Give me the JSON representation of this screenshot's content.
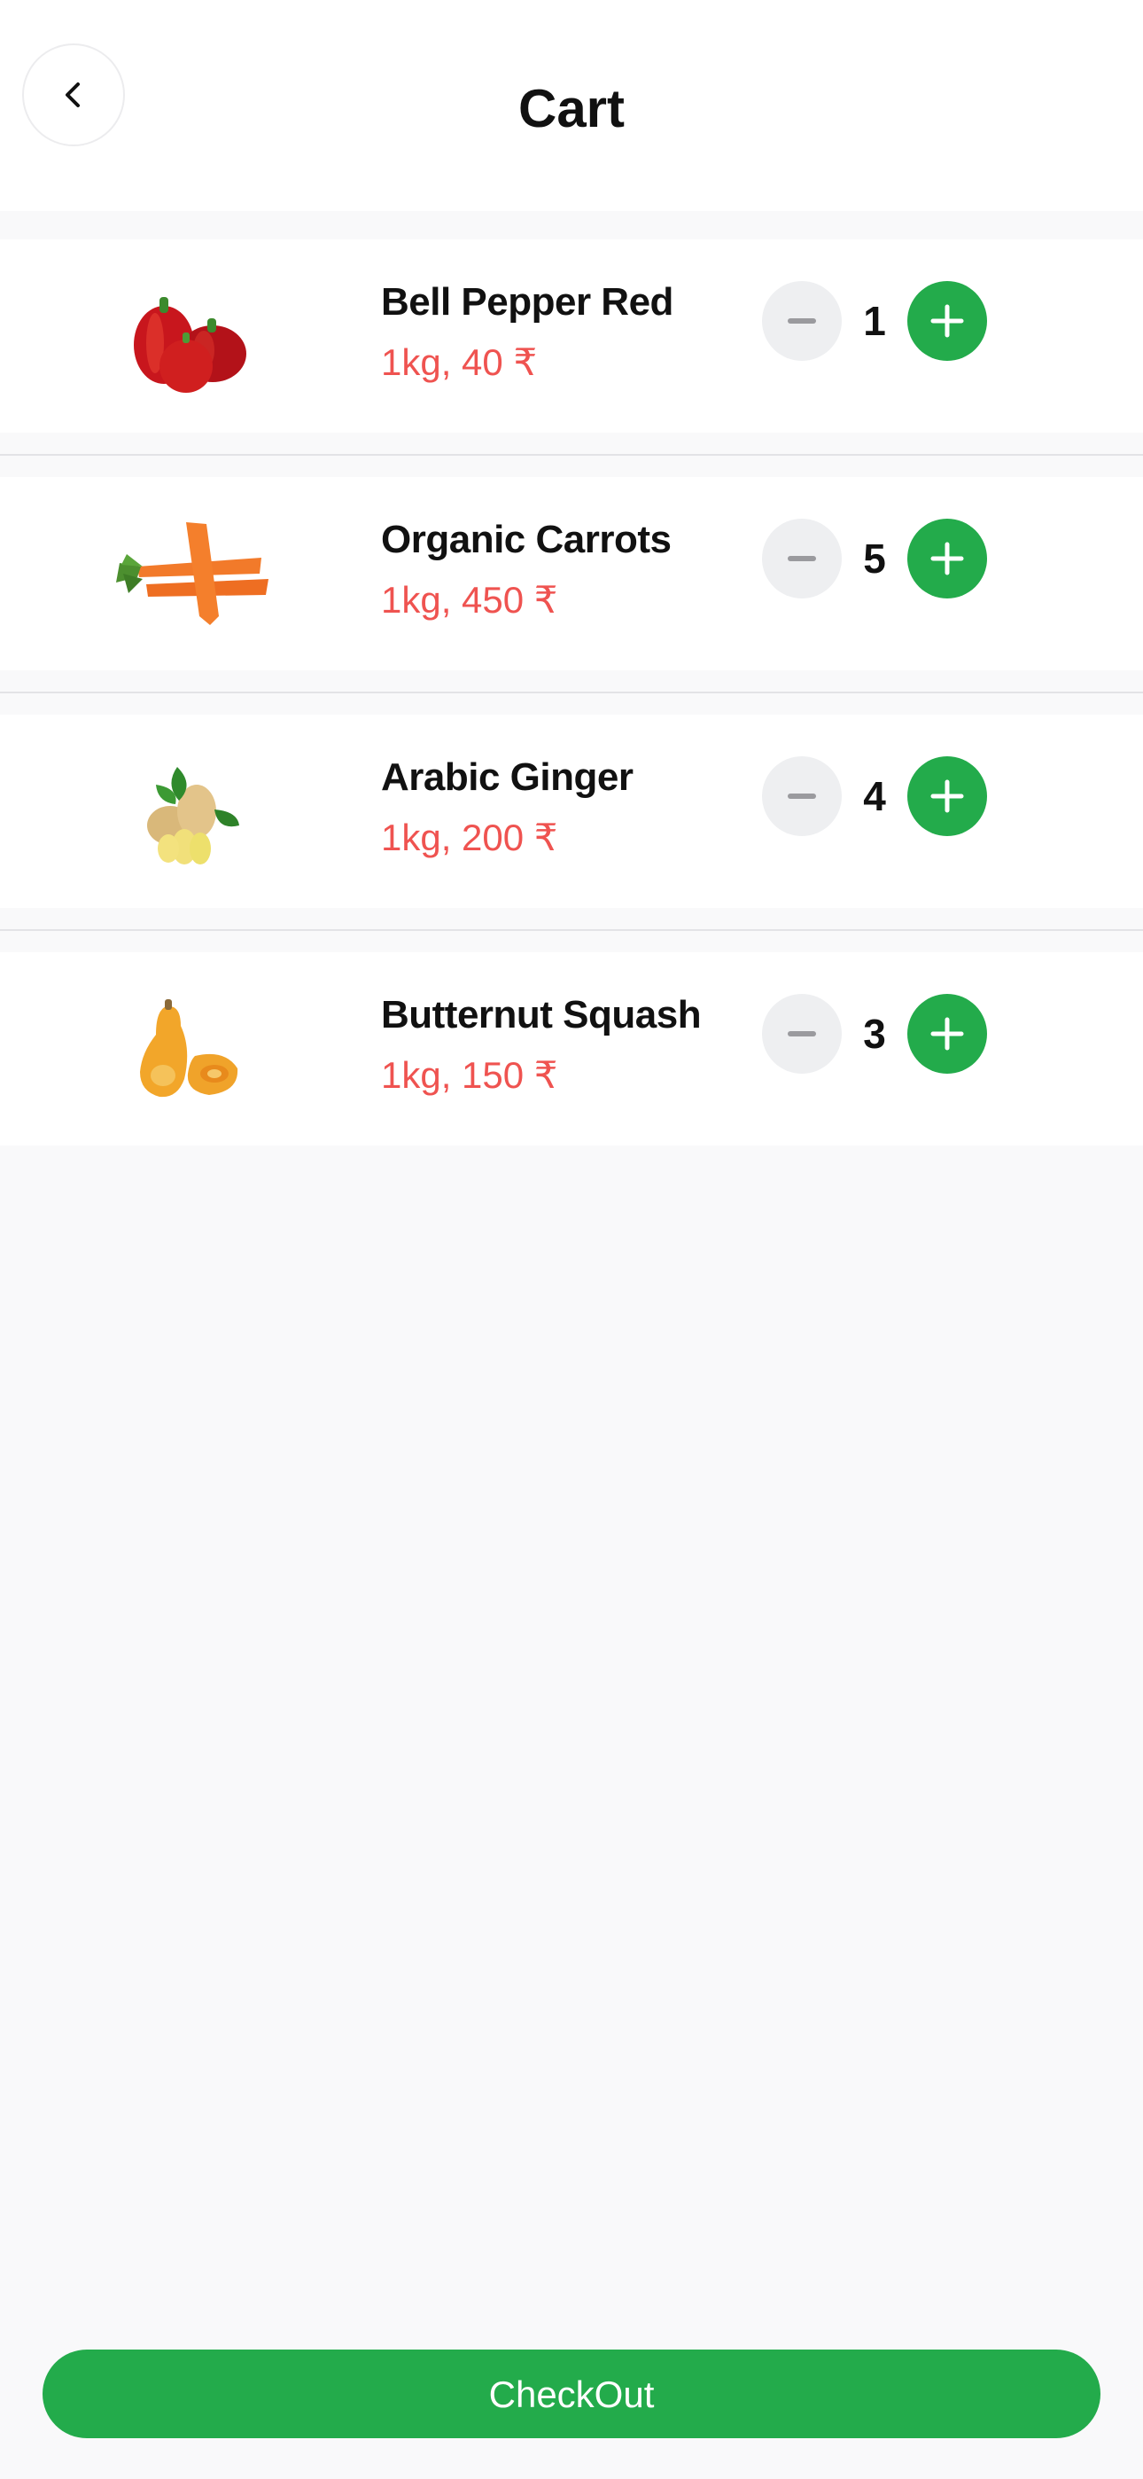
{
  "header": {
    "title": "Cart",
    "back_icon": "chevron-left-icon"
  },
  "items": [
    {
      "name": "Bell Pepper Red",
      "price": "1kg, 40 ₹",
      "qty": "1",
      "image": "bell-pepper-image"
    },
    {
      "name": "Organic Carrots",
      "price": "1kg, 450 ₹",
      "qty": "5",
      "image": "carrots-image"
    },
    {
      "name": "Arabic Ginger",
      "price": "1kg, 200 ₹",
      "qty": "4",
      "image": "ginger-image"
    },
    {
      "name": "Butternut Squash",
      "price": "1kg, 150 ₹",
      "qty": "3",
      "image": "butternut-squash-image"
    }
  ],
  "checkout": {
    "label": "CheckOut"
  },
  "colors": {
    "accent": "#23ab4b",
    "price": "#ef5350",
    "background": "#f9f9fa"
  }
}
